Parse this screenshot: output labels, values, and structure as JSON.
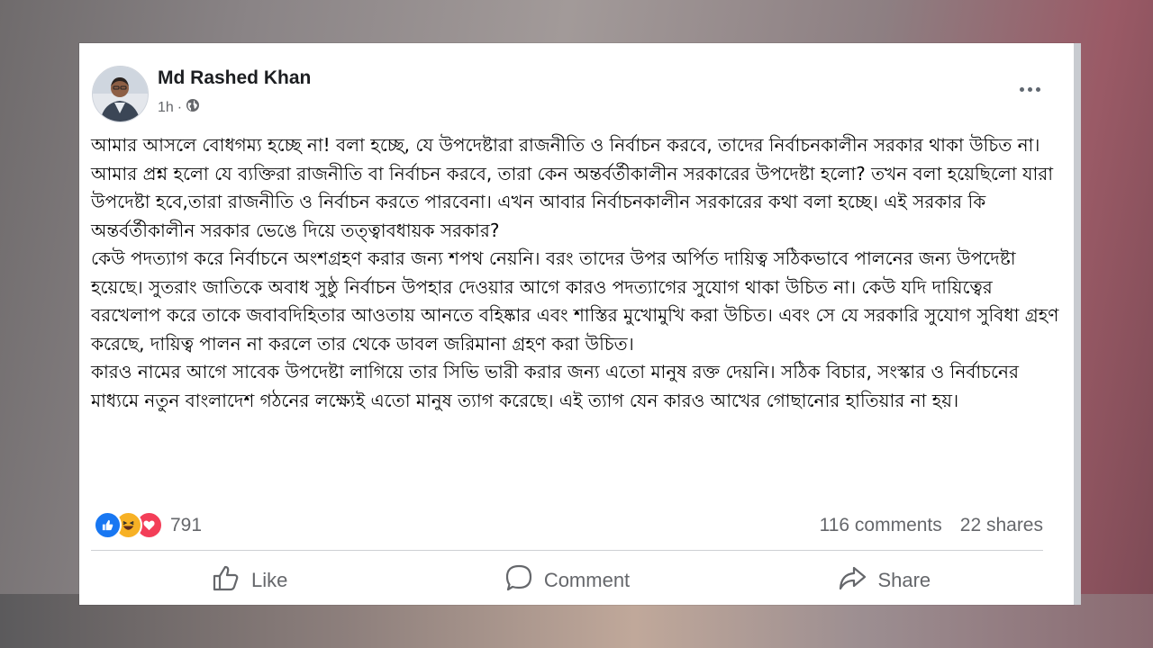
{
  "post": {
    "author": "Md Rashed Khan",
    "time": "1h",
    "separator": "·",
    "privacy_icon": "globe-icon",
    "more_icon": "more-options-icon",
    "text": "আমার আসলে বোধগম্য হচ্ছে না! বলা হচ্ছে, যে উপদেষ্টারা রাজনীতি ও নির্বাচন করবে, তাদের নির্বাচনকালীন সরকার থাকা উচিত না। আমার প্রশ্ন হলো যে ব্যক্তিরা রাজনীতি বা নির্বাচন করবে, তারা কেন অন্তর্বর্তীকালীন সরকারের উপদেষ্টা হলো? তখন বলা হয়েছিলো যারা উপদেষ্টা হবে,তারা রাজনীতি ও নির্বাচন করতে পারবেনা। এখন আবার নির্বাচনকালীন সরকারের কথা বলা হচ্ছে। এই সরকার কি অন্তর্বর্তীকালীন সরকার ভেঙে দিয়ে তত্ত্বাবধায়ক সরকার?\nকেউ পদত্যাগ করে নির্বাচনে অংশগ্রহণ করার জন্য শপথ নেয়নি। বরং তাদের উপর অর্পিত দায়িত্ব সঠিকভাবে পালনের জন্য উপদেষ্টা হয়েছে। সুতরাং জাতিকে অবাধ সুষ্ঠু নির্বাচন উপহার দেওয়ার আগে কারও পদত্যাগের সুযোগ থাকা উচিত না। কেউ যদি দায়িত্বের বরখেলাপ করে তাকে জবাবদিহিতার আওতায় আনতে বহিষ্কার এবং শাস্তির মুখোমুখি করা উচিত। এবং সে যে সরকারি সুযোগ সুবিধা গ্রহণ করেছে, দায়িত্ব পালন না করলে তার থেকে ডাবল জরিমানা গ্রহণ করা উচিত।\nকারও নামের আগে সাবেক উপদেষ্টা লাগিয়ে তার সিভি ভারী করার জন্য এতো মানুষ রক্ত দেয়নি। সঠিক বিচার, সংস্কার ও নির্বাচনের মাধ্যমে নতুন বাংলাদেশ গঠনের লক্ষ্যেই এতো মানুষ ত্যাগ করেছে। এই ত্যাগ যেন কারও আখের গোছানোর হাতিয়ার না হয়।"
  },
  "engagement": {
    "reactions": [
      "like-icon",
      "haha-icon",
      "love-icon"
    ],
    "reaction_count": "791",
    "comments": "116 comments",
    "shares": "22 shares"
  },
  "actions": {
    "like": "Like",
    "comment": "Comment",
    "share": "Share"
  },
  "colors": {
    "like_blue": "#1877f2",
    "haha_yellow": "#f7b125",
    "love_red": "#f33e58",
    "muted_text": "#65676b"
  }
}
